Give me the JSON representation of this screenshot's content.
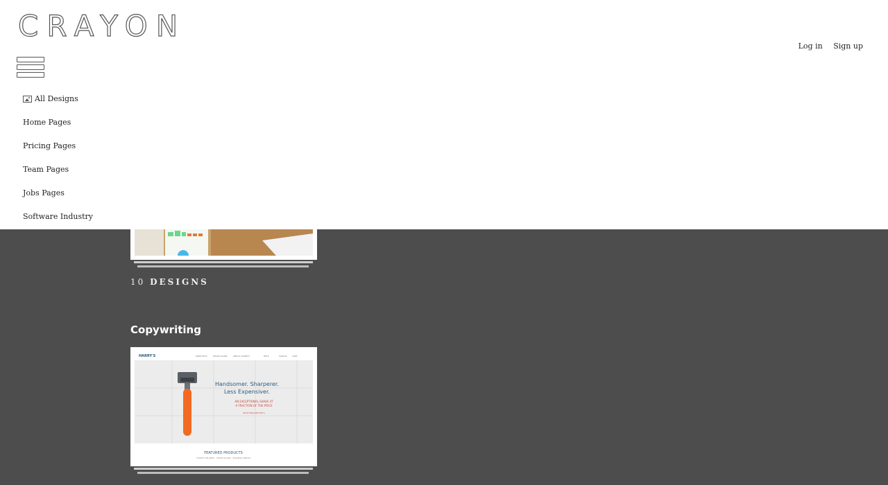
{
  "brand": {
    "logo": "CRAYON"
  },
  "auth": {
    "login": "Log in",
    "signup": "Sign up"
  },
  "nav": {
    "items": [
      {
        "label": "All Designs",
        "icon": "image-icon"
      },
      {
        "label": "Home Pages"
      },
      {
        "label": "Pricing Pages"
      },
      {
        "label": "Team Pages"
      },
      {
        "label": "Jobs Pages"
      },
      {
        "label": "Software Industry"
      }
    ]
  },
  "collections": [
    {
      "count": "10",
      "count_label": "DESIGNS"
    },
    {
      "title": "Copywriting",
      "thumbnail": {
        "brand": "HARRY'S",
        "nav": [
          "PRODUCTS",
          "SHAVE PLANS",
          "ABOUT HARRY'S",
          "HELP",
          "SIGN IN",
          "CART"
        ],
        "headline_1": "Handsomer. Sharperer.",
        "headline_2": "Less Expensiver.",
        "sub_1": "AN EXCEPTIONAL SHAVE AT",
        "sub_2": "A FRACTION OF THE PRICE",
        "cta": "SHOP TRIGGER SET ▸",
        "section": "FEATURED PRODUCTS",
        "section_sub": "HARRY'S BLADES · SHAVE PLANS · SHAVING CREAM"
      }
    }
  ],
  "colors": {
    "background": "#4d4d4d",
    "header": "#ffffff",
    "accent_orange": "#f26a21",
    "harrys_blue": "#2b5a7a"
  }
}
